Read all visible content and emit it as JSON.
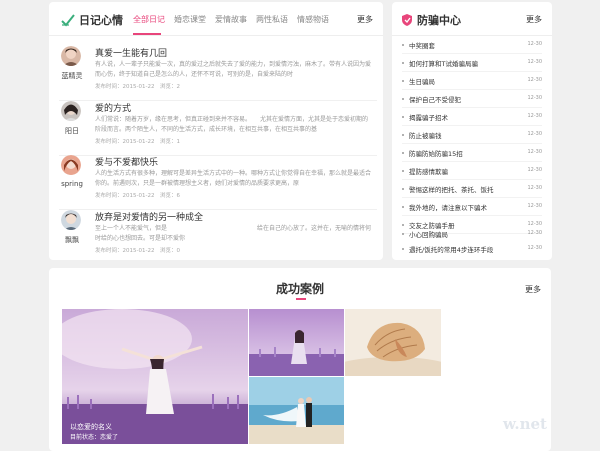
{
  "diary": {
    "title": "日记心情",
    "tabs": [
      {
        "label": "全部日记",
        "active": true
      },
      {
        "label": "婚恋课堂",
        "active": false
      },
      {
        "label": "爱情故事",
        "active": false
      },
      {
        "label": "两性私语",
        "active": false
      },
      {
        "label": "情感物语",
        "active": false
      }
    ],
    "more": "更多",
    "entries": [
      {
        "user": "蓝精灵",
        "title": "真爱一生能有几回",
        "summary": "有人说，人一辈子只能爱一次，真的爱过之后就失去了爱的能力，到爱情污浊，麻木了。带有人说因为爱而心伤，终于知道自己是怎么的人，还怀不可说，可别的是，自爱来陆的时",
        "meta": "发布时间：2015-01-22　浏览：2"
      },
      {
        "user": "阳日",
        "title": "爱的方式",
        "summary": "人们常说：随着万岁，缘在思考，但真正碰到来并不容易。　　尤其在爱情方面，尤其是处于恋爱初期的阶段而言。两个陌生人，不同的生活方式，成长环境，在相互共事，在相互共事的基",
        "meta": "发布时间：2015-01-22　浏览：1"
      },
      {
        "user": "spring",
        "title": "爱与不爱都快乐",
        "summary": "人的生活方式有很多种，理解可是差异生活方式中的一种。哪种方式让你觉得自在幸福，那么就是最适合你的。前遇则次，只是一群被情理想主义者，她们对爱情的品质要求更高，原",
        "meta": "发布时间：2015-01-22　浏览：6"
      },
      {
        "user": "飘飘",
        "title": "放弃是对爱情的另一种成全",
        "summary": "至上一个人不能爱气，但是　　　　　　　　　　　　　　　给在自己的心放了。这并在，无喻的情将何时给的心也想回去。可是却不爱你",
        "meta": "发布时间：2015-01-22　浏览：0"
      }
    ]
  },
  "fraud": {
    "title": "防骗中心",
    "more": "更多",
    "items": [
      {
        "text": "中奖圈套",
        "date": "12-30"
      },
      {
        "text": "如何打算和T试婚骗局骗",
        "date": "12-30"
      },
      {
        "text": "生日骗局",
        "date": "12-30"
      },
      {
        "text": "保护自己不受侵犯",
        "date": "12-30"
      },
      {
        "text": "揭露骗子招术",
        "date": "12-30"
      },
      {
        "text": "防止被骗钱",
        "date": "12-30"
      },
      {
        "text": "防骗防始防骗15招",
        "date": "12-30"
      },
      {
        "text": "提防感情欺骗",
        "date": "12-30"
      },
      {
        "text": "警惕这样的把托、茶托、饭托",
        "date": "12-30"
      },
      {
        "text": "我外地的，请注意以下骗术",
        "date": "12-30"
      },
      {
        "text": "交友之防骗手册",
        "date": "12-30"
      },
      {
        "text": "小心回购骗局",
        "date": "12-30"
      },
      {
        "text": "遇托/饭托的常用4步连环手段",
        "date": "12-30"
      }
    ]
  },
  "cases": {
    "title": "成功案例",
    "more": "更多",
    "featured_caption": "以恋爱的名义",
    "featured_status": "目前状态：恋爱了"
  },
  "watermark": "w.net"
}
